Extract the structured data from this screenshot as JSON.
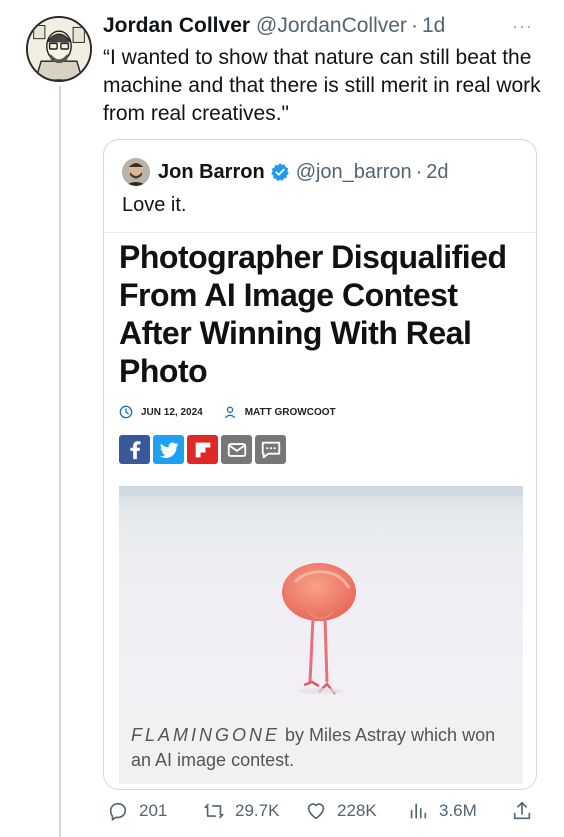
{
  "tweet": {
    "author_name": "Jordan Collver",
    "author_handle": "@JordanCollver",
    "separator": "·",
    "age": "1d",
    "more": "···",
    "text": "“I wanted to show that nature can still beat the machine and that there is still merit in real work from real creatives.\""
  },
  "quote": {
    "author_name": "Jon Barron",
    "author_handle": "@jon_barron",
    "separator": "·",
    "age": "2d",
    "text": "Love it.",
    "verified_color": "#1d9bf0"
  },
  "article": {
    "headline": "Photographer Disqualified From AI Image Contest After Winning With Real Photo",
    "date": "JUN 12, 2024",
    "author": "MATT GROWCOOT",
    "share_buttons": [
      {
        "name": "facebook",
        "color": "#3b5998"
      },
      {
        "name": "twitter",
        "color": "#1da1f2"
      },
      {
        "name": "flipboard",
        "color": "#e12828"
      },
      {
        "name": "email",
        "color": "#777777"
      },
      {
        "name": "comment",
        "color": "#777777"
      }
    ],
    "caption_title": "FLAMINGONE",
    "caption_rest": " by Miles Astray which won an AI image contest."
  },
  "actions": {
    "replies": "201",
    "retweets": "29.7K",
    "likes": "228K",
    "views": "3.6M"
  }
}
